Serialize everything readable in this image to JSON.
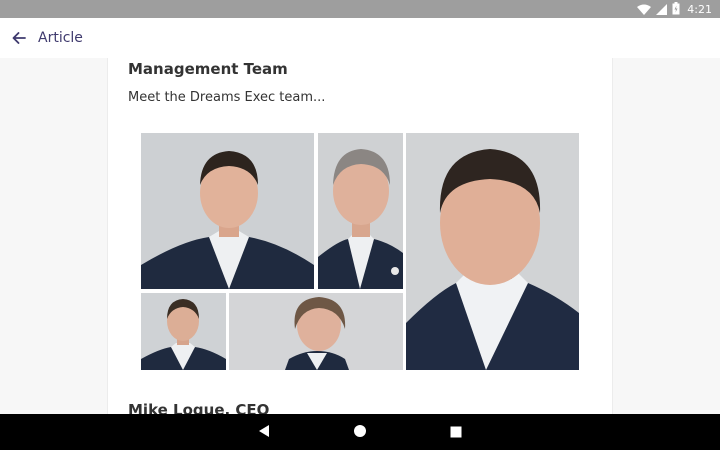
{
  "status_bar": {
    "time": "4:21",
    "icons": [
      "wifi-icon",
      "signal-icon",
      "battery-icon"
    ]
  },
  "app_bar": {
    "title": "Article",
    "back_icon": "arrow-back-icon"
  },
  "article": {
    "section_heading": "Management Team",
    "intro": "Meet the Dreams Exec team...",
    "photos": [
      "executive-portrait-1",
      "executive-portrait-2",
      "executive-portrait-3",
      "executive-portrait-4",
      "executive-portrait-5"
    ],
    "next_heading": "Mike Logue, CEO"
  },
  "nav_bar": {
    "icons": [
      "back-triangle-icon",
      "home-circle-icon",
      "overview-square-icon"
    ]
  },
  "colors": {
    "accent": "#3f3a6e",
    "status_bar": "#9e9e9e",
    "nav_bar": "#000000"
  }
}
